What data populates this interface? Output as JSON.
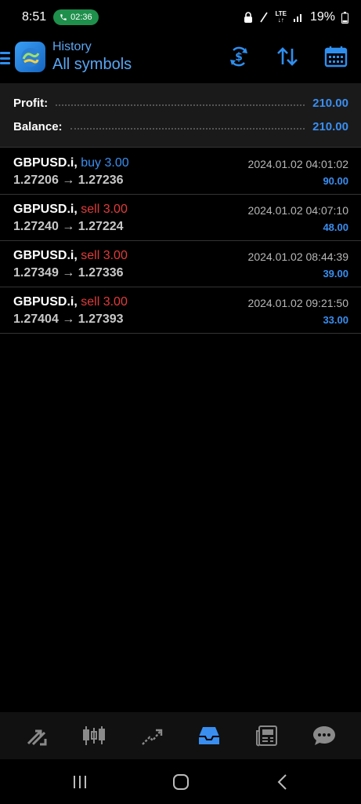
{
  "status_bar": {
    "time": "8:51",
    "call_timer": "02:36",
    "network": "LTE",
    "battery": "19%"
  },
  "header": {
    "subtitle": "History",
    "title": "All symbols"
  },
  "summary": {
    "profit_label": "Profit:",
    "profit_value": "210.00",
    "balance_label": "Balance:",
    "balance_value": "210.00"
  },
  "deals": [
    {
      "symbol": "GBPUSD.i,",
      "side": "buy 3.00",
      "prices": "1.27206 → 1.27236",
      "time": "2024.01.02 04:01:02",
      "profit": "90.00"
    },
    {
      "symbol": "GBPUSD.i,",
      "side": "sell 3.00",
      "prices": "1.27240 → 1.27224",
      "time": "2024.01.02 04:07:10",
      "profit": "48.00"
    },
    {
      "symbol": "GBPUSD.i,",
      "side": "sell 3.00",
      "prices": "1.27349 → 1.27336",
      "time": "2024.01.02 08:44:39",
      "profit": "39.00"
    },
    {
      "symbol": "GBPUSD.i,",
      "side": "sell 3.00",
      "prices": "1.27404 → 1.27393",
      "time": "2024.01.02 09:21:50",
      "profit": "33.00"
    }
  ],
  "colors": {
    "accent": "#3a8ef0",
    "buy": "#3a8ef0",
    "sell": "#e23b3b",
    "call_pill": "#1f8f4c"
  },
  "icons": {
    "header": [
      "currency-exchange-icon",
      "sort-icon",
      "calendar-icon"
    ],
    "tabs": [
      "quotes-icon",
      "chart-candles-icon",
      "trade-icon",
      "history-icon",
      "news-icon",
      "messages-icon"
    ],
    "nav": [
      "recents-icon",
      "home-icon",
      "back-icon"
    ]
  }
}
